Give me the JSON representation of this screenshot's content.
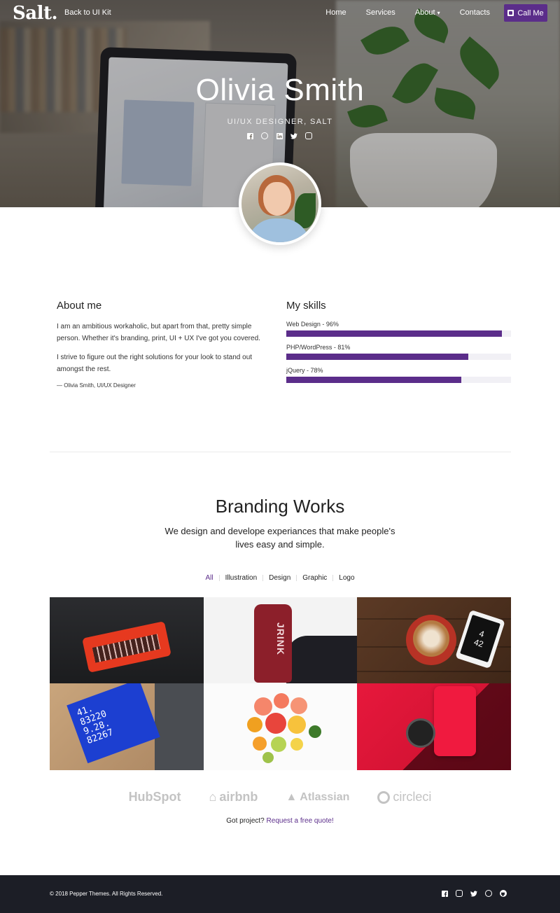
{
  "nav": {
    "logo": "Salt.",
    "back_link": "Back to UI Kit",
    "items": [
      {
        "label": "Home"
      },
      {
        "label": "Services"
      },
      {
        "label": "About"
      },
      {
        "label": "Contacts"
      }
    ],
    "call_label": "Call Me"
  },
  "hero": {
    "name": "Olivia Smith",
    "role": "UI/UX DESIGNER, SALT",
    "social_icons": [
      "facebook-icon",
      "dribbble-icon",
      "linkedin-icon",
      "twitter-icon",
      "instagram-icon"
    ]
  },
  "about": {
    "title": "About me",
    "p1": "I am an ambitious workaholic, but apart from that, pretty simple person. Whether it's branding, print, UI + UX I've got you covered.",
    "p2": "I strive to figure out the right solutions for your look to stand out amongst the rest.",
    "signature": "— Olivia Smith, UI/UX Designer"
  },
  "skills": {
    "title": "My skills",
    "items": [
      {
        "label": "Web Design - 96%",
        "percent": 96
      },
      {
        "label": "PHP/WordPress - 81%",
        "percent": 81
      },
      {
        "label": "jQuery - 78%",
        "percent": 78
      }
    ]
  },
  "branding": {
    "title": "Branding Works",
    "subtitle": "We design and develope experiances that make people's lives easy and simple.",
    "filters": [
      {
        "label": "All",
        "active": true
      },
      {
        "label": "Illustration",
        "active": false
      },
      {
        "label": "Design",
        "active": false
      },
      {
        "label": "Graphic",
        "active": false
      },
      {
        "label": "Logo",
        "active": false
      }
    ],
    "tile_text": {
      "bottle_label": "JRINK",
      "phone_time_h": "4",
      "phone_time_m": "42",
      "book_digits": "41.\n83220\n9.28.\n82267"
    }
  },
  "clients": {
    "logos": [
      "HubSpot",
      "airbnb",
      "Atlassian",
      "circleci"
    ]
  },
  "quote": {
    "prefix": "Got project?",
    "link": "Request a free quote!"
  },
  "footer": {
    "copyright": "© 2018 Pepper Themes. All Rights Reserved.",
    "social_icons": [
      "facebook-icon",
      "instagram-icon",
      "twitter-icon",
      "dribbble-icon",
      "github-icon"
    ]
  },
  "colors": {
    "accent": "#5b2d8a",
    "footer_bg": "#1c1e26",
    "skill_track": "#f1f0f5"
  }
}
